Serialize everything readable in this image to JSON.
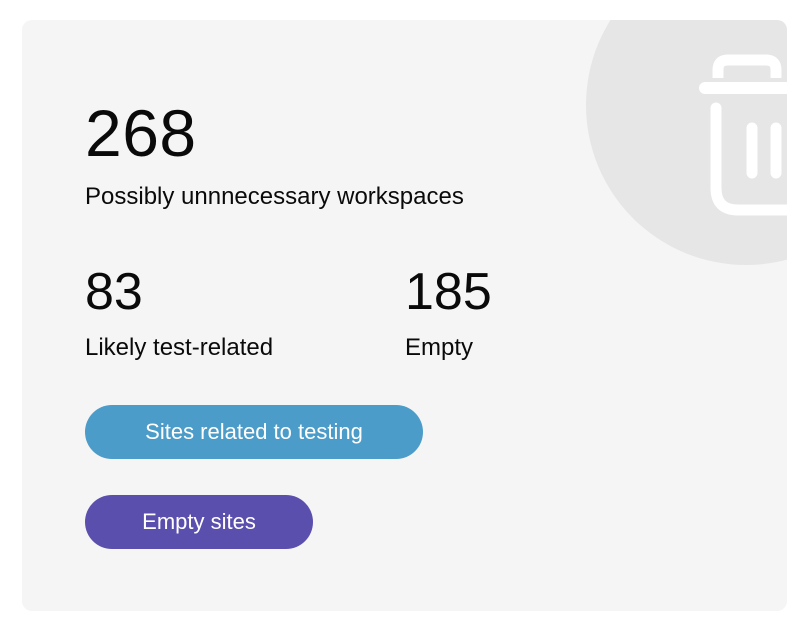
{
  "summary": {
    "total_count": "268",
    "total_label": "Possibly unnnecessary workspaces"
  },
  "stats": [
    {
      "count": "83",
      "label": "Likely test-related"
    },
    {
      "count": "185",
      "label": "Empty"
    }
  ],
  "buttons": {
    "testing": {
      "label": "Sites related to testing",
      "color": "#4b9cc9"
    },
    "empty": {
      "label": "Empty sites",
      "color": "#5b4fae"
    }
  },
  "decor": {
    "icon": "trash-icon",
    "circle_color": "#e6e6e6",
    "card_color": "#f5f5f5"
  }
}
